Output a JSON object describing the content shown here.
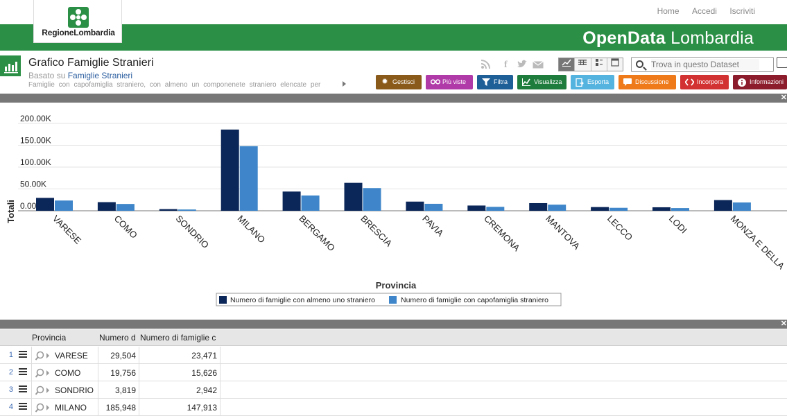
{
  "header": {
    "top_links": [
      "Home",
      "Accedi",
      "Iscriviti"
    ],
    "logo_text": "RegioneLombardia",
    "brand_bold": "OpenData",
    "brand_rest": " Lombardia"
  },
  "dataset": {
    "title": "Grafico Famiglie Stranieri",
    "based_prefix": "Basato su ",
    "based_link": "Famiglie Stranieri",
    "description": "Famiglie con capofamiglia straniero, con almeno un componenete straniero elencate per"
  },
  "search": {
    "placeholder": "Trova in questo Dataset"
  },
  "actions": [
    {
      "label": "Gestisci",
      "color": "#8a5a1a",
      "icon": "gear-icon"
    },
    {
      "label": "Più viste",
      "color": "#b03aa8",
      "icon": "glasses-icon"
    },
    {
      "label": "Filtra",
      "color": "#1f5f98",
      "icon": "filter-icon"
    },
    {
      "label": "Visualizza",
      "color": "#1e7c3c",
      "icon": "chart-icon"
    },
    {
      "label": "Esporta",
      "color": "#55b3e0",
      "icon": "export-icon"
    },
    {
      "label": "Discussione",
      "color": "#ee7a1a",
      "icon": "comment-icon"
    },
    {
      "label": "Incorpora",
      "color": "#d33232",
      "icon": "code-icon"
    },
    {
      "label": "Informazioni",
      "color": "#8c1c2c",
      "icon": "info-icon"
    }
  ],
  "chart_data": {
    "type": "bar",
    "title": "",
    "xlabel": "Provincia",
    "ylabel": "Totali",
    "ylim": [
      0,
      200000
    ],
    "yticks": [
      "0.00",
      "50.00K",
      "100.00K",
      "150.00K",
      "200.00K"
    ],
    "categories": [
      "VARESE",
      "COMO",
      "SONDRIO",
      "MILANO",
      "BERGAMO",
      "BRESCIA",
      "PAVIA",
      "CREMONA",
      "MANTOVA",
      "LECCO",
      "LODI",
      "MONZA E DELLA"
    ],
    "series": [
      {
        "name": "Numero di famiglie con almeno uno straniero",
        "color": "#0b2658",
        "values": [
          29504,
          19756,
          3819,
          185948,
          44000,
          64000,
          21000,
          12000,
          17500,
          8500,
          8000,
          24500
        ]
      },
      {
        "name": "Numero di famiglie con capofamiglia straniero",
        "color": "#3e86c9",
        "values": [
          23471,
          15626,
          2942,
          147913,
          35000,
          52000,
          16000,
          9000,
          14000,
          6800,
          6200,
          19000
        ]
      }
    ],
    "legend_position": "bottom-center",
    "grid": true
  },
  "table": {
    "headers": [
      "Provincia",
      "Numero d",
      "Numero di famiglie c"
    ],
    "rows": [
      {
        "n": "1",
        "provincia": "VARESE",
        "a": "29,504",
        "b": "23,471"
      },
      {
        "n": "2",
        "provincia": "COMO",
        "a": "19,756",
        "b": "15,626"
      },
      {
        "n": "3",
        "provincia": "SONDRIO",
        "a": "3,819",
        "b": "2,942"
      },
      {
        "n": "4",
        "provincia": "MILANO",
        "a": "185,948",
        "b": "147,913"
      }
    ]
  }
}
